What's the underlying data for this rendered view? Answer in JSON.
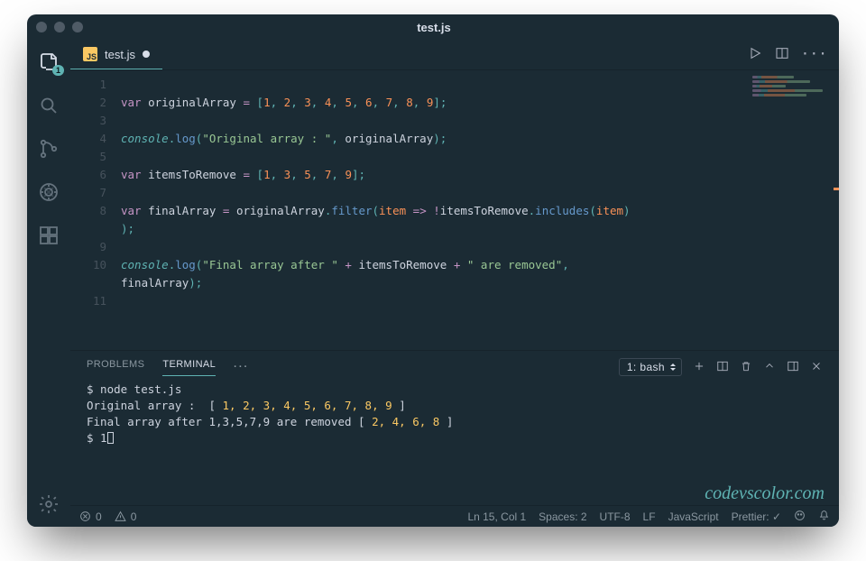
{
  "window": {
    "title": "test.js"
  },
  "tab": {
    "jsIcon": "JS",
    "filename": "test.js"
  },
  "explorerBadge": "1",
  "code": {
    "lines": [
      "",
      "var originalArray = [1, 2, 3, 4, 5, 6, 7, 8, 9];",
      "",
      "console.log(\"Original array : \", originalArray);",
      "",
      "var itemsToRemove = [1, 3, 5, 7, 9];",
      "",
      "var finalArray = originalArray.filter(item => !itemsToRemove.includes(item));",
      "",
      "console.log(\"Final array after \" + itemsToRemove + \" are removed\", finalArray);",
      ""
    ],
    "lineNumbers": [
      "1",
      "2",
      "3",
      "4",
      "5",
      "6",
      "7",
      "8",
      "9",
      "10",
      "11"
    ]
  },
  "panel": {
    "tabs": {
      "problems": "PROBLEMS",
      "terminal": "TERMINAL"
    },
    "select": "1: bash"
  },
  "terminal": {
    "l1": "$ node test.js",
    "l2_a": "Original array :  [ ",
    "l2_b": "1, 2, 3, 4, 5, 6, 7, 8, 9",
    "l2_c": " ]",
    "l3_a": "Final array after 1,3,5,7,9 are removed [ ",
    "l3_b": "2, 4, 6, 8",
    "l3_c": " ]",
    "l4": "$ 1"
  },
  "watermark": "codevscolor.com",
  "status": {
    "errors": "0",
    "warnings": "0",
    "lncol": "Ln 15, Col 1",
    "spaces": "Spaces: 2",
    "encoding": "UTF-8",
    "eol": "LF",
    "lang": "JavaScript",
    "prettier": "Prettier: ✓"
  }
}
